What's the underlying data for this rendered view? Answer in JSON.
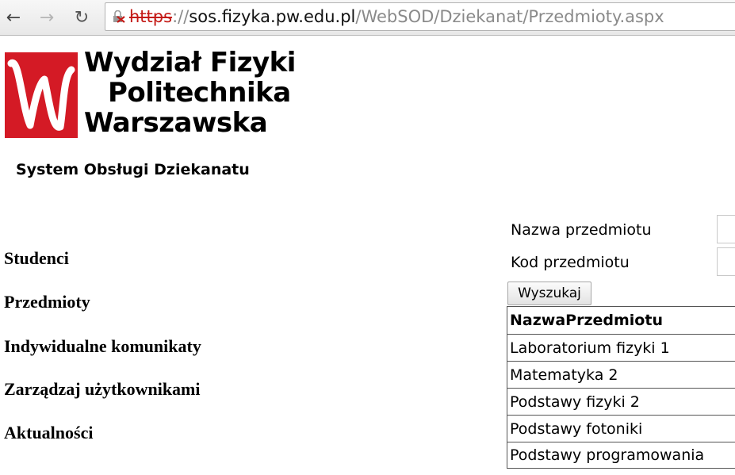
{
  "browser": {
    "url_scheme": "https",
    "url_separator": "://",
    "url_host": "sos.fizyka.pw.edu.pl",
    "url_path": "/WebSOD/Dziekanat/Przedmioty.aspx"
  },
  "header": {
    "faculty_line1": "Wydział Fizyki",
    "faculty_line2": "Politechnika",
    "faculty_line3": "Warszawska",
    "system_name": "System Obsługi Dziekanatu"
  },
  "menu": {
    "items": [
      {
        "label": "Studenci"
      },
      {
        "label": "Przedmioty"
      },
      {
        "label": "Indywidualne komunikaty"
      },
      {
        "label": "Zarządzaj użytkownikami"
      },
      {
        "label": "Aktualności"
      }
    ]
  },
  "search": {
    "name_label": "Nazwa przedmiotu",
    "code_label": "Kod przedmiotu",
    "name_value": "",
    "code_value": "",
    "button_label": "Wyszukaj"
  },
  "results": {
    "header": "NazwaPrzedmiotu",
    "rows": [
      "Laboratorium fizyki 1",
      "Matematyka 2",
      "Podstawy fizyki 2",
      "Podstawy fotoniki",
      "Podstawy programowania"
    ]
  },
  "colors": {
    "logo_red": "#d41a25",
    "insecure_scheme": "#c41a16"
  },
  "icons": {
    "back": "arrow-left-icon",
    "forward": "arrow-right-icon",
    "reload": "reload-icon",
    "security": "broken-lock-icon"
  }
}
